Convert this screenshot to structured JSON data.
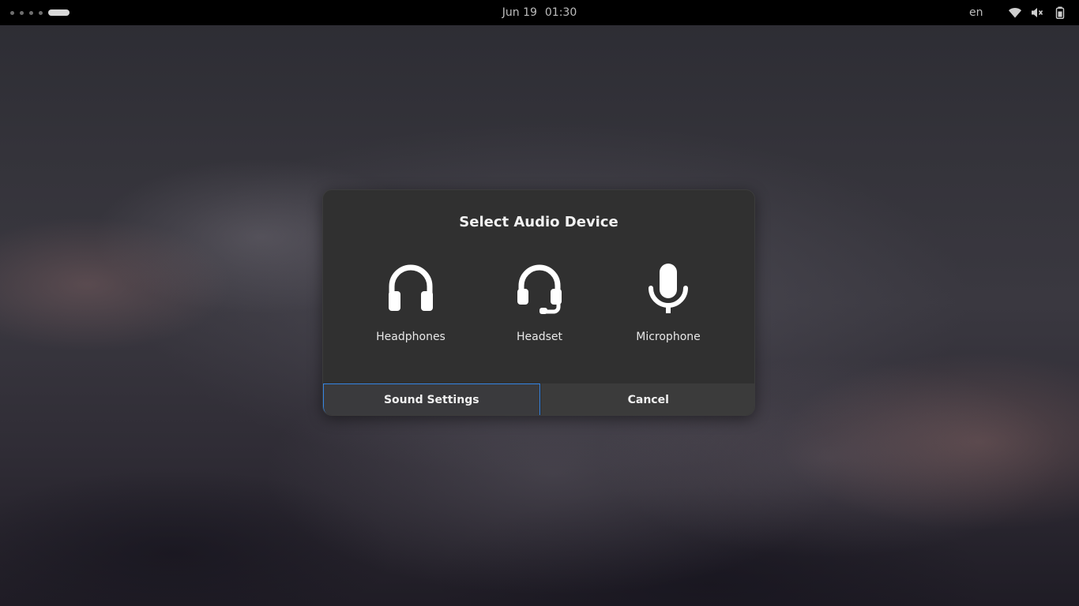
{
  "topbar": {
    "clock_date": "Jun 19",
    "clock_time": "01:30",
    "keyboard_layout": "en",
    "icons": [
      "workspace-indicator",
      "wifi-icon",
      "volume-muted-icon",
      "battery-icon"
    ]
  },
  "dialog": {
    "title": "Select Audio Device",
    "devices": [
      {
        "label": "Headphones",
        "icon": "headphones-icon"
      },
      {
        "label": "Headset",
        "icon": "headset-icon"
      },
      {
        "label": "Microphone",
        "icon": "microphone-icon"
      }
    ],
    "buttons": {
      "sound_settings": "Sound Settings",
      "cancel": "Cancel"
    }
  },
  "colors": {
    "topbar_bg": "#000000",
    "dialog_bg": "#303030",
    "focus_accent": "#3584e4",
    "text": "#f2f2f2"
  }
}
